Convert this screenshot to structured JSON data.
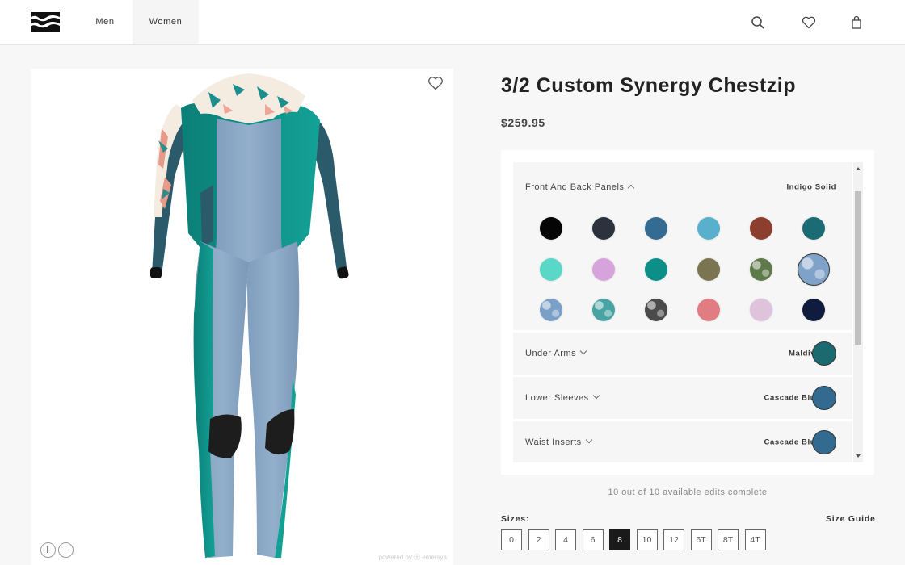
{
  "header": {
    "logo": "billabong-logo",
    "nav": [
      {
        "label": "Men",
        "active": false
      },
      {
        "label": "Women",
        "active": true
      }
    ],
    "icons": [
      "search-icon",
      "heart-icon",
      "shopping-bag-icon"
    ]
  },
  "viewer": {
    "favorite_icon": "heart-icon",
    "zoom_in_icon": "plus-icon",
    "zoom_out_icon": "minus-icon",
    "powered_by": "powered by ⓔ emersya"
  },
  "product": {
    "title": "3/2 Custom Synergy Chestzip",
    "price": "$259.95"
  },
  "config": {
    "sections": [
      {
        "label": "Front And Back Panels",
        "expanded": true,
        "value": "Indigo Solid",
        "swatches": [
          {
            "name": "Black",
            "color": "#050505"
          },
          {
            "name": "Dark Charcoal",
            "color": "#2c313e"
          },
          {
            "name": "Cascade Blue",
            "color": "#336b92"
          },
          {
            "name": "Sky Blue",
            "color": "#58b0cc"
          },
          {
            "name": "Rust",
            "color": "#8c3e2f"
          },
          {
            "name": "Maldive",
            "color": "#1a6b73"
          },
          {
            "name": "Aqua",
            "color": "#59d8c7"
          },
          {
            "name": "Lilac",
            "color": "#d7a3dc"
          },
          {
            "name": "Teal",
            "color": "#0c8f86"
          },
          {
            "name": "Olive",
            "color": "#7a7550"
          },
          {
            "name": "Camo",
            "color": "#5f7a4a",
            "pattern": true
          },
          {
            "name": "Indigo Solid",
            "color": "#7fa2c9",
            "selected": true,
            "pattern": true
          },
          {
            "name": "Blue Floral",
            "color": "#7aa0c8",
            "pattern": true
          },
          {
            "name": "Tropical Floral",
            "color": "#4aa3a3",
            "pattern": true
          },
          {
            "name": "Black Floral",
            "color": "#4b4b4b",
            "pattern": true
          },
          {
            "name": "Coral",
            "color": "#e07c82"
          },
          {
            "name": "Pale Pink",
            "color": "#dfc3dd"
          },
          {
            "name": "Navy",
            "color": "#101c3e"
          }
        ]
      },
      {
        "label": "Under Arms",
        "expanded": false,
        "value": "Maldive",
        "color": "#1b6a70"
      },
      {
        "label": "Lower Sleeves",
        "expanded": false,
        "value": "Cascade Blue",
        "color": "#336a8f"
      },
      {
        "label": "Waist Inserts",
        "expanded": false,
        "value": "Cascade Blue",
        "color": "#336a8f"
      }
    ],
    "edits_status": "10 out of 10 available edits complete"
  },
  "sizes": {
    "label": "Sizes:",
    "guide_label": "Size Guide",
    "options": [
      "0",
      "2",
      "4",
      "6",
      "8",
      "10",
      "12",
      "6T",
      "8T",
      "4T"
    ],
    "selected": "8"
  }
}
